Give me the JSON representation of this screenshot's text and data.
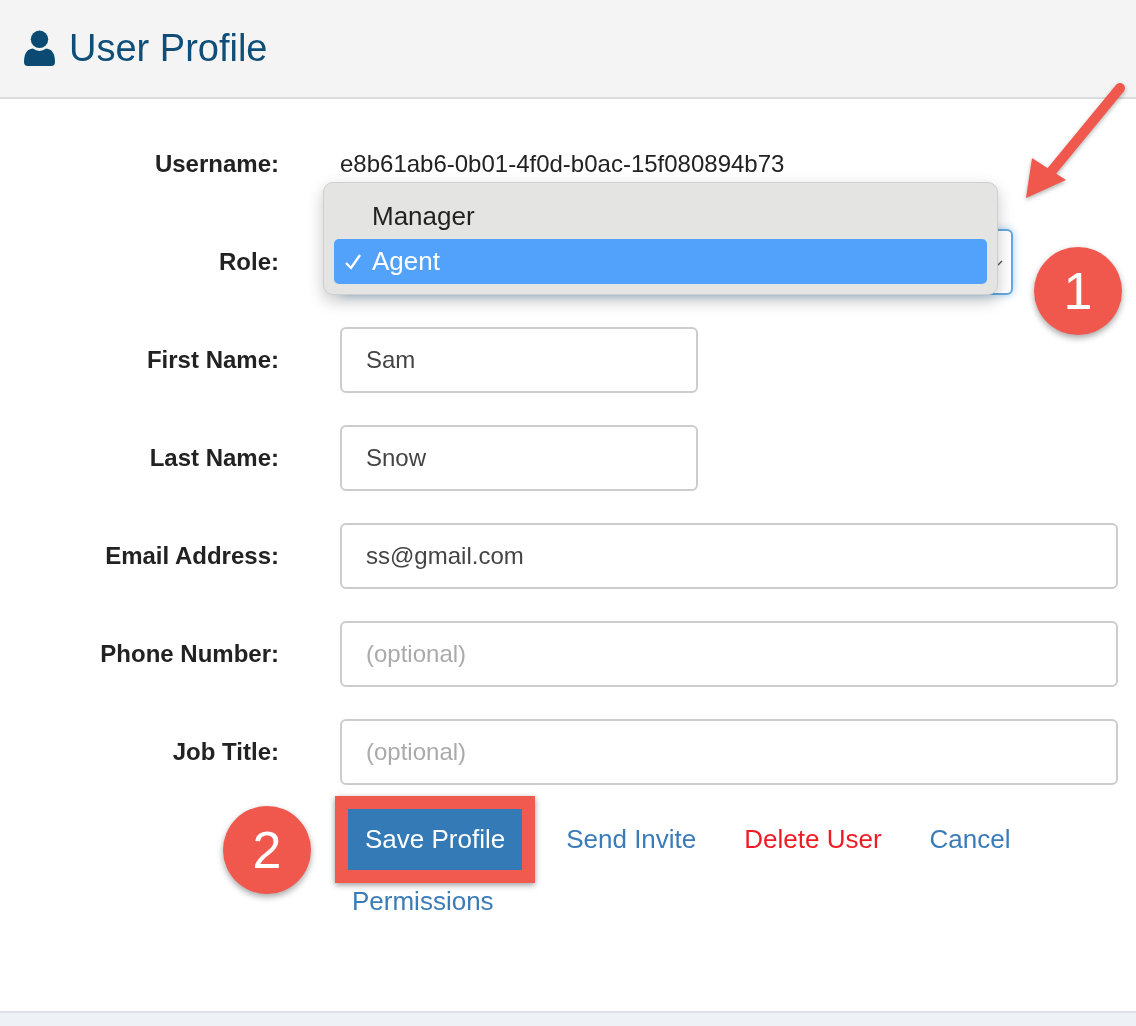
{
  "header": {
    "title": "User Profile"
  },
  "fields": [
    {
      "kind": "static",
      "label": "Username:",
      "value": "e8b61ab6-0b01-4f0d-b0ac-15f080894b73"
    },
    {
      "kind": "select",
      "label": "Role:",
      "open": true,
      "options": [
        {
          "label": "Manager",
          "selected": false
        },
        {
          "label": "Agent",
          "selected": true
        }
      ]
    },
    {
      "kind": "input",
      "label": "First Name:",
      "value": "Sam",
      "wide": false
    },
    {
      "kind": "input",
      "label": "Last Name:",
      "value": "Snow",
      "wide": false
    },
    {
      "kind": "input",
      "label": "Email Address:",
      "value": "ss@gmail.com",
      "wide": true
    },
    {
      "kind": "input",
      "label": "Phone Number:",
      "placeholder": "(optional)",
      "wide": true
    },
    {
      "kind": "input",
      "label": "Job Title:",
      "placeholder": "(optional)",
      "wide": true
    }
  ],
  "actions": [
    {
      "kind": "primary",
      "label": "Save Profile",
      "highlighted": true
    },
    {
      "kind": "link",
      "label": "Send Invite",
      "highlighted": false
    },
    {
      "kind": "danger",
      "label": "Delete User",
      "highlighted": false
    },
    {
      "kind": "link",
      "label": "Cancel",
      "highlighted": false
    },
    {
      "kind": "link",
      "label": "Permissions",
      "highlighted": false
    }
  ],
  "annotations": [
    {
      "number": "1",
      "arrow": true
    },
    {
      "number": "2",
      "arrow": false
    }
  ]
}
